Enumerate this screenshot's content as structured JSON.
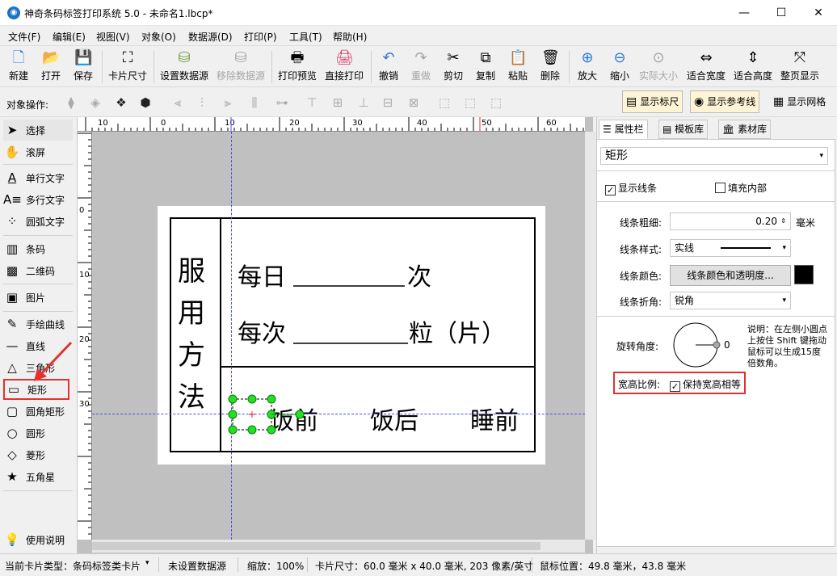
{
  "window": {
    "title": "神奇条码标签打印系统 5.0 - 未命名1.lbcp*",
    "app_icon_glyph": "◉"
  },
  "menu": [
    "文件(F)",
    "编辑(E)",
    "视图(V)",
    "对象(O)",
    "数据源(D)",
    "打印(P)",
    "工具(T)",
    "帮助(H)"
  ],
  "toolbar": [
    {
      "label": "新建",
      "icon": "new-file-icon",
      "glyph": "🗋",
      "enabled": true
    },
    {
      "label": "打开",
      "icon": "open-icon",
      "glyph": "📂",
      "enabled": true
    },
    {
      "label": "保存",
      "icon": "save-icon",
      "glyph": "💾",
      "enabled": true
    },
    {
      "label": "卡片尺寸",
      "icon": "card-size-icon",
      "glyph": "⛶",
      "enabled": true
    },
    {
      "label": "设置数据源",
      "icon": "database-icon",
      "glyph": "⛁",
      "enabled": true
    },
    {
      "label": "移除数据源",
      "icon": "remove-database-icon",
      "glyph": "⛁",
      "enabled": false
    },
    {
      "label": "打印预览",
      "icon": "print-preview-icon",
      "glyph": "🖶",
      "enabled": true
    },
    {
      "label": "直接打印",
      "icon": "print-icon",
      "glyph": "🖨",
      "enabled": true
    },
    {
      "label": "撤销",
      "icon": "undo-icon",
      "glyph": "↶",
      "enabled": true
    },
    {
      "label": "重做",
      "icon": "redo-icon",
      "glyph": "↷",
      "enabled": false
    },
    {
      "label": "剪切",
      "icon": "cut-icon",
      "glyph": "✂",
      "enabled": true
    },
    {
      "label": "复制",
      "icon": "copy-icon",
      "glyph": "⧉",
      "enabled": true
    },
    {
      "label": "粘贴",
      "icon": "paste-icon",
      "glyph": "📋",
      "enabled": true
    },
    {
      "label": "删除",
      "icon": "delete-icon",
      "glyph": "🗑",
      "enabled": true
    },
    {
      "label": "放大",
      "icon": "zoom-in-icon",
      "glyph": "⊕",
      "enabled": true
    },
    {
      "label": "缩小",
      "icon": "zoom-out-icon",
      "glyph": "⊖",
      "enabled": true
    },
    {
      "label": "实际大小",
      "icon": "actual-size-icon",
      "glyph": "⊙",
      "enabled": false
    },
    {
      "label": "适合宽度",
      "icon": "fit-width-icon",
      "glyph": "⇔",
      "enabled": true
    },
    {
      "label": "适合高度",
      "icon": "fit-height-icon",
      "glyph": "⇕",
      "enabled": true
    },
    {
      "label": "整页显示",
      "icon": "fit-page-icon",
      "glyph": "⤧",
      "enabled": true
    }
  ],
  "objbar": {
    "label": "对象操作:",
    "toggles": [
      {
        "label": "显示标尺",
        "icon": "ruler-icon",
        "glyph": "▤",
        "active": true
      },
      {
        "label": "显示参考线",
        "icon": "eye-icon",
        "glyph": "◉",
        "active": true
      },
      {
        "label": "显示网格",
        "icon": "grid-icon",
        "glyph": "▦",
        "active": false
      }
    ]
  },
  "tools": [
    {
      "label": "选择",
      "icon": "pointer-icon",
      "glyph": "➤"
    },
    {
      "label": "滚屏",
      "icon": "hand-icon",
      "glyph": "✋"
    },
    {
      "label": "单行文字",
      "icon": "single-line-text-icon",
      "glyph": "A"
    },
    {
      "label": "多行文字",
      "icon": "multi-line-text-icon",
      "glyph": "A≡"
    },
    {
      "label": "圆弧文字",
      "icon": "arc-text-icon",
      "glyph": "⁘"
    },
    {
      "label": "条码",
      "icon": "barcode-icon",
      "glyph": "▥"
    },
    {
      "label": "二维码",
      "icon": "qrcode-icon",
      "glyph": "▩"
    },
    {
      "label": "图片",
      "icon": "image-icon",
      "glyph": "▣"
    },
    {
      "label": "手绘曲线",
      "icon": "freehand-icon",
      "glyph": "✎"
    },
    {
      "label": "直线",
      "icon": "line-icon",
      "glyph": "—"
    },
    {
      "label": "三角形",
      "icon": "triangle-icon",
      "glyph": "△"
    },
    {
      "label": "矩形",
      "icon": "rectangle-icon",
      "glyph": "▭"
    },
    {
      "label": "圆角矩形",
      "icon": "rounded-rectangle-icon",
      "glyph": "▢"
    },
    {
      "label": "圆形",
      "icon": "circle-icon",
      "glyph": "○"
    },
    {
      "label": "菱形",
      "icon": "diamond-icon",
      "glyph": "◇"
    },
    {
      "label": "五角星",
      "icon": "star-icon",
      "glyph": "★"
    },
    {
      "label": "使用说明",
      "icon": "lightbulb-icon",
      "glyph": "💡"
    }
  ],
  "ruler": {
    "top_labels": [
      "10",
      "0",
      "10",
      "20",
      "30",
      "40",
      "50",
      "60"
    ],
    "left_labels": [
      "0",
      "10",
      "20",
      "30"
    ]
  },
  "label_content": {
    "side_text": [
      "服",
      "用",
      "方",
      "法"
    ],
    "line1_prefix": "每日",
    "line1_suffix": "次",
    "line2_prefix": "每次",
    "line2_suffix": "粒（片）",
    "opt1": "饭前",
    "opt2": "饭后",
    "opt3": "睡前"
  },
  "right_tabs": [
    {
      "label": "属性栏",
      "icon": "properties-icon",
      "glyph": "☰"
    },
    {
      "label": "模板库",
      "icon": "template-icon",
      "glyph": "▤"
    },
    {
      "label": "素材库",
      "icon": "library-icon",
      "glyph": "🏛"
    }
  ],
  "props": {
    "object_type": "矩形",
    "show_line": "显示线条",
    "fill_inside": "填充内部",
    "line_width_label": "线条粗细:",
    "line_width_value": "0.20",
    "unit": "毫米",
    "line_style_label": "线条样式:",
    "line_style_value": "实线",
    "line_color_label": "线条颜色:",
    "line_color_button": "线条颜色和透明度...",
    "line_color": "#000000",
    "line_corner_label": "线条折角:",
    "line_corner_value": "锐角",
    "rotation_label": "旋转角度:",
    "rotation_value": "0",
    "rotation_help": "说明：在左侧小圆点上按住 Shift 键拖动鼠标可以生成15度倍数角。",
    "aspect_label": "宽高比例:",
    "aspect_keep": "保持宽高相等"
  },
  "status": {
    "card_type": "当前卡片类型：条码标签类卡片",
    "datasource": "未设置数据源",
    "zoom": "缩放：100%",
    "card_size": "卡片尺寸：60.0 毫米 x 40.0 毫米, 203 像素/英寸",
    "mouse": "鼠标位置：49.8 毫米，43.8 毫米"
  },
  "colors": {
    "highlight_red": "#e53030",
    "selection_green": "#22e022",
    "guide_blue": "#4c4cf0"
  }
}
